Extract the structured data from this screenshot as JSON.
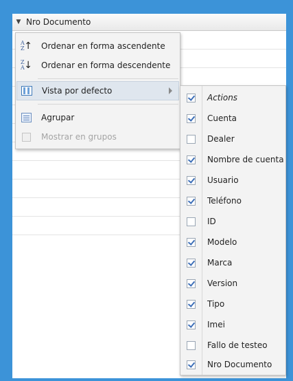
{
  "grid": {
    "header_label": "Nro Documento"
  },
  "menu": {
    "items": [
      {
        "label": "Ordenar en forma ascendente",
        "icon": "sort-ascending-icon",
        "disabled": false
      },
      {
        "label": "Ordenar en forma descendente",
        "icon": "sort-descending-icon",
        "disabled": false
      },
      {
        "label": "Vista por defecto",
        "icon": "columns-icon",
        "disabled": false,
        "active": true,
        "has_submenu": true
      },
      {
        "label": "Agrupar",
        "icon": "group-icon",
        "disabled": false
      },
      {
        "label": "Mostrar en grupos",
        "icon": "checkbox-icon",
        "disabled": true
      }
    ]
  },
  "columns_submenu": {
    "items": [
      {
        "label": "Actions",
        "checked": true,
        "italic": true
      },
      {
        "label": "Cuenta",
        "checked": true
      },
      {
        "label": "Dealer",
        "checked": false
      },
      {
        "label": "Nombre de cuenta",
        "checked": true
      },
      {
        "label": "Usuario",
        "checked": true
      },
      {
        "label": "Teléfono",
        "checked": true
      },
      {
        "label": "ID",
        "checked": false
      },
      {
        "label": "Modelo",
        "checked": true
      },
      {
        "label": "Marca",
        "checked": true
      },
      {
        "label": "Version",
        "checked": true
      },
      {
        "label": "Tipo",
        "checked": true
      },
      {
        "label": "Imei",
        "checked": true
      },
      {
        "label": "Fallo de testeo",
        "checked": false
      },
      {
        "label": "Nro Documento",
        "checked": true
      }
    ]
  },
  "colors": {
    "frame": "#3c93d8",
    "menu_bg": "#f3f3f3",
    "active_bg": "#dfe6ee",
    "check_mark": "#3d6fb8"
  }
}
